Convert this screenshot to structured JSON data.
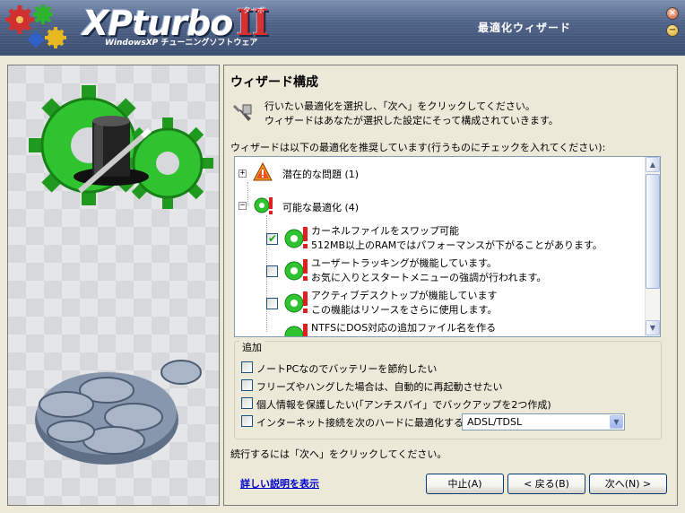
{
  "header": {
    "logo_main": "XPturbo",
    "logo_roman": "II",
    "logo_ruby": "ターボ",
    "logo_sub_brand": "WindowsXP",
    "logo_sub_text": "チューニングソフトウェア",
    "wizard_title": "最適化ウィザード",
    "close_glyph": "×",
    "min_glyph": "−"
  },
  "main": {
    "section_title": "ウィザード構成",
    "intro_line1": "行いたい最適化を選択し、「次へ」をクリックしてください。",
    "intro_line2": "ウィザードはあなたが選択した設定にそって構成されていきます。",
    "recommend_text": "ウィザードは以下の最適化を推奨しています(行うものにチェックを入れてください):"
  },
  "tree": {
    "groups": [
      {
        "label": "潜在的な問題 (1)",
        "expander": "+"
      },
      {
        "label": "可能な最適化 (4)",
        "expander": "−"
      }
    ],
    "items": [
      {
        "line1": "カーネルファイルをスワップ可能",
        "line2": "512MB以上のRAMではパフォーマンスが下がることがあります。",
        "checked": true
      },
      {
        "line1": "ユーザートラッキングが機能しています。",
        "line2": "お気に入りとスタートメニューの強調が行われます。",
        "checked": false
      },
      {
        "line1": "アクティブデスクトップが機能しています",
        "line2": "この機能はリソースをさらに使用します。",
        "checked": false
      },
      {
        "line1": "NTFSにDOS対応の追加ファイル名を作る",
        "line2": "",
        "checked": false
      }
    ]
  },
  "extra": {
    "legend": "追加",
    "options": [
      {
        "label": "ノートPCなのでバッテリーを節約したい",
        "checked": false
      },
      {
        "label": "フリーズやハングした場合は、自動的に再起動させたい",
        "checked": false
      },
      {
        "label": "個人情報を保護したい(「アンチスパイ」でバックアップを2つ作成)",
        "checked": false
      },
      {
        "label": "インターネット接続を次のハードに最適化する:",
        "checked": false
      }
    ],
    "connection_select": "ADSL/TDSL"
  },
  "footer": {
    "continue_text": "続行するには「次へ」をクリックしてください。",
    "help_link": "詳しい説明を表示",
    "cancel_button": "中止(A)",
    "back_button": "< 戻る(B)",
    "next_button": "次へ(N) >"
  },
  "colors": {
    "header_bg": "#4f6388",
    "panel_bg": "#ece9d8",
    "gear_green": "#2db32d",
    "warning_red": "#e02020",
    "link_blue": "#0000cc"
  }
}
